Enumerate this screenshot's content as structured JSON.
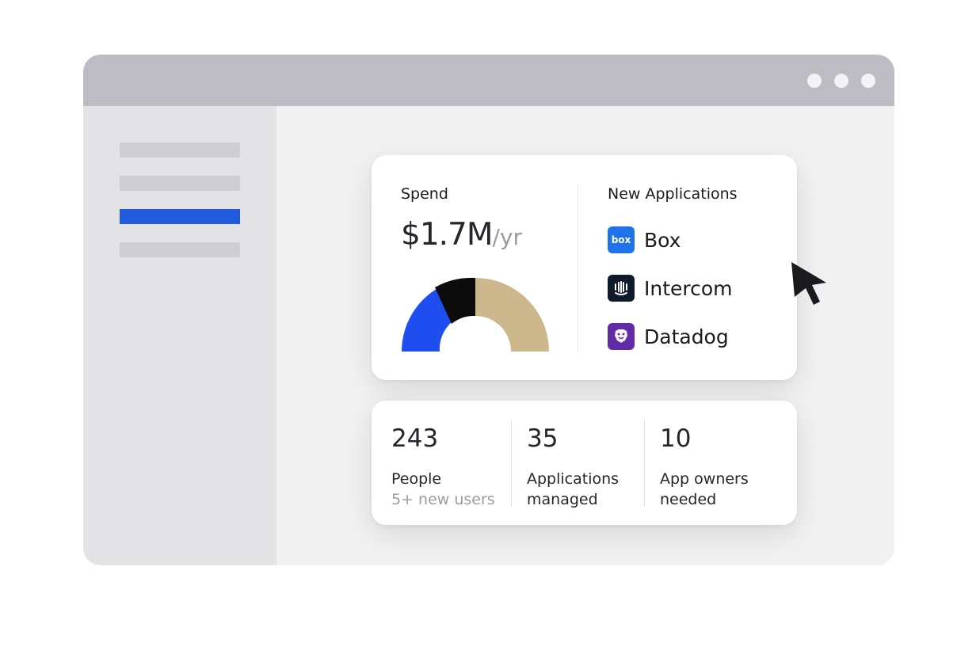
{
  "spend": {
    "label": "Spend",
    "amount": "$1.7M",
    "unit": "/yr",
    "gauge": {
      "segments": [
        {
          "name": "blue",
          "color": "#1f4ef0"
        },
        {
          "name": "black",
          "color": "#0c0c0c"
        },
        {
          "name": "tan",
          "color": "#cdb88d"
        }
      ]
    }
  },
  "new_apps": {
    "label": "New Applications",
    "items": [
      {
        "name": "Box",
        "icon": "box-logo-icon",
        "color": "#1e73e8",
        "logo_text": "box"
      },
      {
        "name": "Intercom",
        "icon": "intercom-logo-icon",
        "color": "#0f1a2a"
      },
      {
        "name": "Datadog",
        "icon": "datadog-logo-icon",
        "color": "#632ca6"
      }
    ]
  },
  "stats": [
    {
      "value": "243",
      "label": "People",
      "sub": "5+ new users"
    },
    {
      "value": "35",
      "label_line1": "Applications",
      "label_line2": "managed"
    },
    {
      "value": "10",
      "label_line1": "App owners",
      "label_line2": "needed"
    }
  ],
  "colors": {
    "accent": "#1f5bdc"
  }
}
